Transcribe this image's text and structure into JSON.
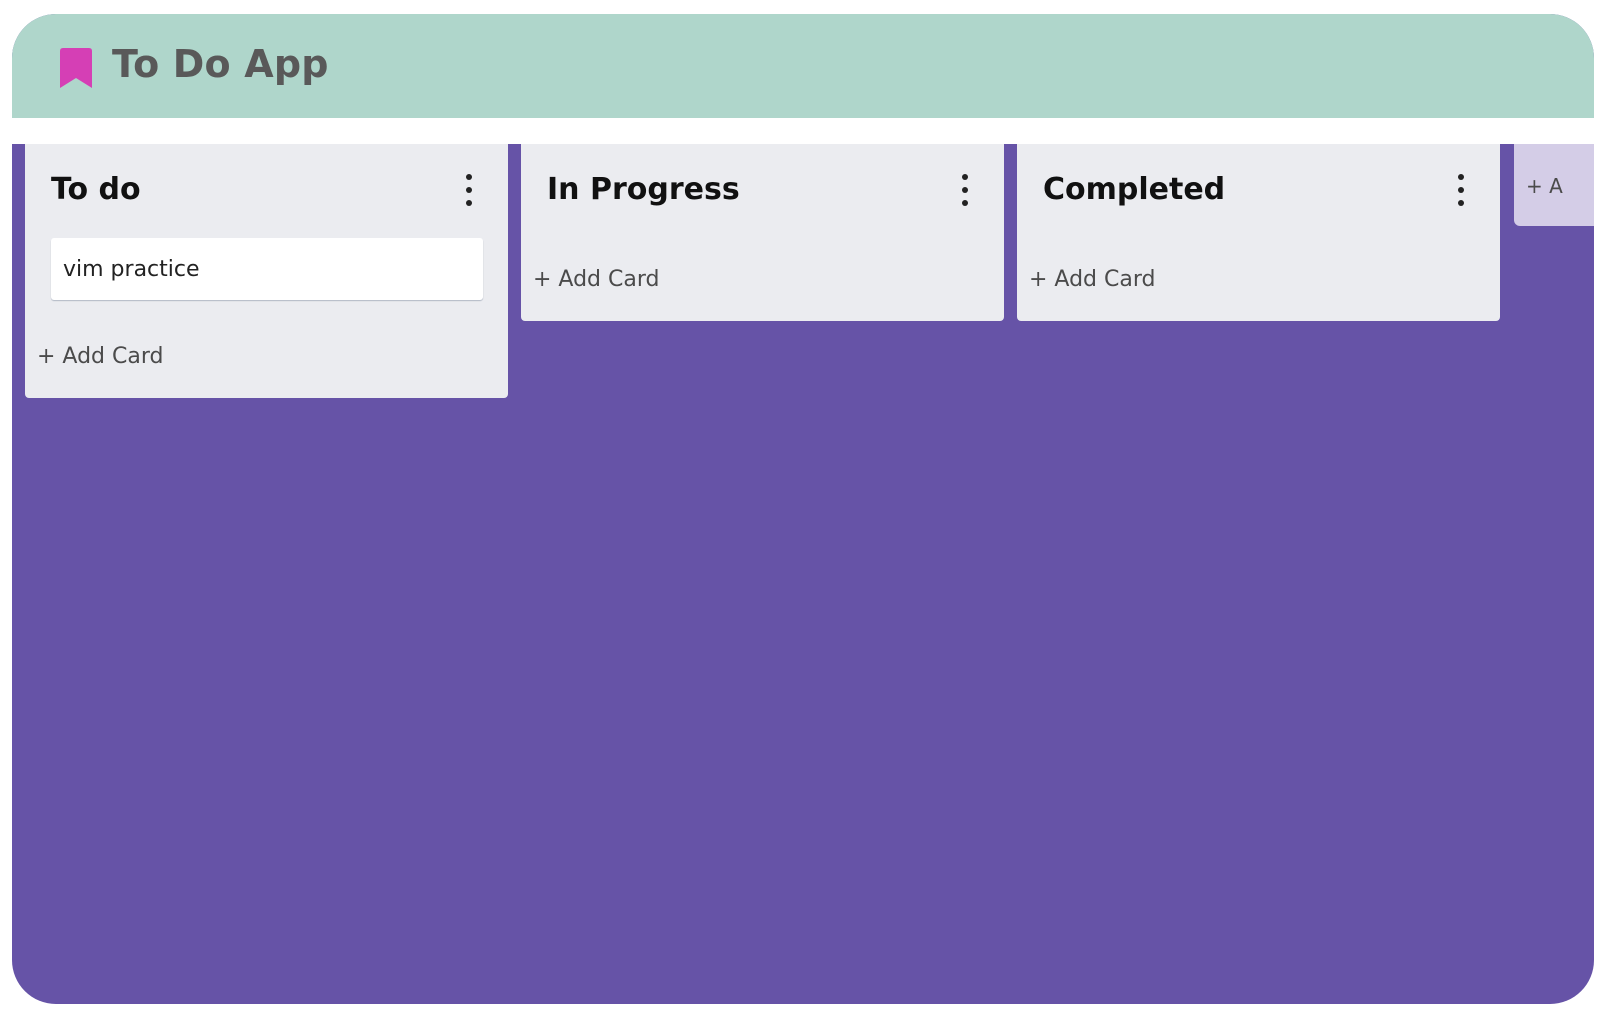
{
  "app": {
    "title": "To Do App",
    "bookmark_icon": "bookmark-icon",
    "colors": {
      "header": "#afd6cb",
      "board": "#6653a7",
      "list": "#ebecf0",
      "bookmark": "#d53fb5"
    }
  },
  "lists": [
    {
      "title": "To do",
      "menu_icon": "more-vertical-icon",
      "cards": [
        "vim practice"
      ],
      "add_card_label": "+ Add Card"
    },
    {
      "title": "In Progress",
      "menu_icon": "more-vertical-icon",
      "cards": [],
      "add_card_label": "+ Add Card"
    },
    {
      "title": "Completed",
      "menu_icon": "more-vertical-icon",
      "cards": [],
      "add_card_label": "+ Add Card"
    }
  ],
  "add_list": {
    "label": "+ A"
  }
}
